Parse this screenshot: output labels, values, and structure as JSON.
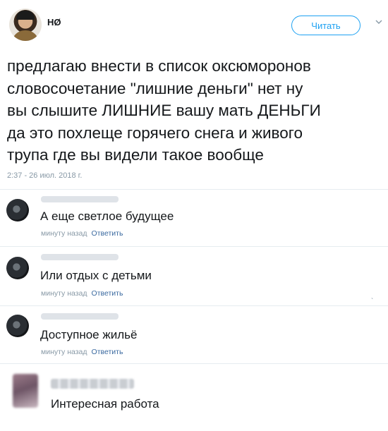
{
  "tweet": {
    "author_name": "HØ",
    "follow_label": "Читать",
    "text": "предлагаю внести в список оксюморонов\nсловосочетание \"лишние деньги\" нет ну\nвы слышите ЛИШНИЕ вашу мать ДЕНЬГИ\nда это похлеще горячего снега и живого\nтрупа где вы видели такое вообще",
    "timestamp": "2:37 - 26 июл. 2018 г."
  },
  "replies": [
    {
      "text": "А еще светлое будущее",
      "time": "минуту назад",
      "reply_label": "Ответить"
    },
    {
      "text": "Или отдых с детьми",
      "time": "минуту назад",
      "reply_label": "Ответить"
    },
    {
      "text": "Доступное жильё",
      "time": "минуту назад",
      "reply_label": "Ответить"
    }
  ],
  "last_comment": {
    "text": "Интересная работа"
  },
  "colors": {
    "accent": "#1da1f2",
    "link": "#3b6aa0",
    "muted": "#8899a6"
  }
}
